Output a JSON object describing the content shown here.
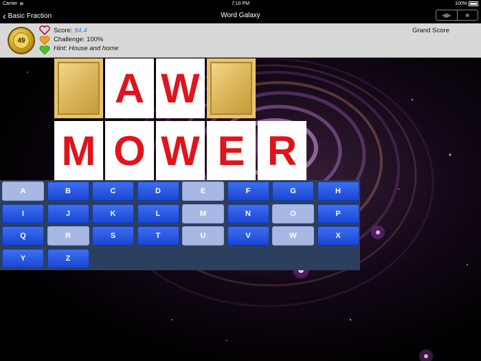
{
  "status_bar": {
    "carrier": "Carrier",
    "time": "7:10 PM",
    "battery": "100%"
  },
  "nav": {
    "back_label": "Basic Fraction",
    "title": "Word Galaxy"
  },
  "score_panel": {
    "coin_value": "49",
    "score_label": "Score:",
    "score_value": "94.4",
    "challenge": "Challenge: 100%",
    "hint": "Hint: House and home",
    "grand_score": "Grand Score"
  },
  "puzzle": {
    "row1": [
      "",
      "A",
      "W",
      ""
    ],
    "row2": [
      "M",
      "O",
      "W",
      "E",
      "R"
    ]
  },
  "keyboard": {
    "keys": [
      {
        "label": "A",
        "used": true
      },
      {
        "label": "B",
        "used": false
      },
      {
        "label": "C",
        "used": false
      },
      {
        "label": "D",
        "used": false
      },
      {
        "label": "E",
        "used": true
      },
      {
        "label": "F",
        "used": false
      },
      {
        "label": "G",
        "used": false
      },
      {
        "label": "H",
        "used": false
      },
      {
        "label": "I",
        "used": false
      },
      {
        "label": "J",
        "used": false
      },
      {
        "label": "K",
        "used": false
      },
      {
        "label": "L",
        "used": false
      },
      {
        "label": "M",
        "used": true
      },
      {
        "label": "N",
        "used": false
      },
      {
        "label": "O",
        "used": true
      },
      {
        "label": "P",
        "used": false
      },
      {
        "label": "Q",
        "used": false
      },
      {
        "label": "R",
        "used": true
      },
      {
        "label": "S",
        "used": false
      },
      {
        "label": "T",
        "used": false
      },
      {
        "label": "U",
        "used": true
      },
      {
        "label": "V",
        "used": false
      },
      {
        "label": "W",
        "used": true
      },
      {
        "label": "X",
        "used": false
      },
      {
        "label": "Y",
        "used": false
      },
      {
        "label": "Z",
        "used": false
      }
    ]
  },
  "colors": {
    "tile_letter": "#e0141c",
    "key_active": "#2a5ae6",
    "key_used": "#a7b8e4",
    "score_value": "#3a7be0"
  }
}
